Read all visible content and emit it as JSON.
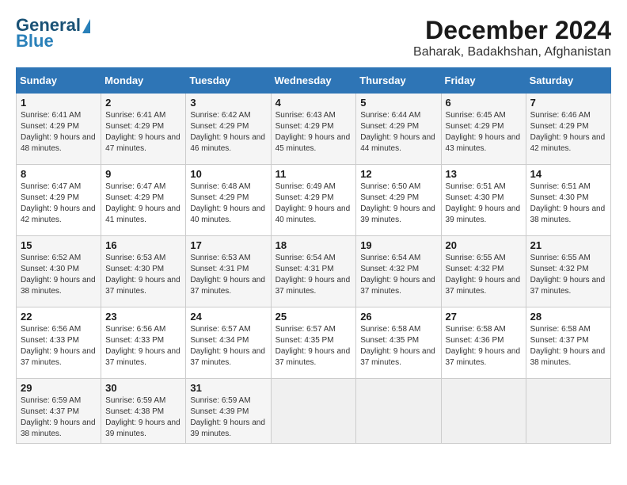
{
  "header": {
    "logo_line1": "General",
    "logo_line2": "Blue",
    "title": "December 2024",
    "subtitle": "Baharak, Badakhshan, Afghanistan"
  },
  "calendar": {
    "columns": [
      "Sunday",
      "Monday",
      "Tuesday",
      "Wednesday",
      "Thursday",
      "Friday",
      "Saturday"
    ],
    "weeks": [
      [
        {
          "day": "",
          "sunrise": "",
          "sunset": "",
          "daylight": ""
        },
        {
          "day": "",
          "sunrise": "",
          "sunset": "",
          "daylight": ""
        },
        {
          "day": "",
          "sunrise": "",
          "sunset": "",
          "daylight": ""
        },
        {
          "day": "",
          "sunrise": "",
          "sunset": "",
          "daylight": ""
        },
        {
          "day": "",
          "sunrise": "",
          "sunset": "",
          "daylight": ""
        },
        {
          "day": "",
          "sunrise": "",
          "sunset": "",
          "daylight": ""
        },
        {
          "day": "",
          "sunrise": "",
          "sunset": "",
          "daylight": ""
        }
      ],
      [
        {
          "day": "1",
          "sunrise": "Sunrise: 6:41 AM",
          "sunset": "Sunset: 4:29 PM",
          "daylight": "Daylight: 9 hours and 48 minutes."
        },
        {
          "day": "2",
          "sunrise": "Sunrise: 6:41 AM",
          "sunset": "Sunset: 4:29 PM",
          "daylight": "Daylight: 9 hours and 47 minutes."
        },
        {
          "day": "3",
          "sunrise": "Sunrise: 6:42 AM",
          "sunset": "Sunset: 4:29 PM",
          "daylight": "Daylight: 9 hours and 46 minutes."
        },
        {
          "day": "4",
          "sunrise": "Sunrise: 6:43 AM",
          "sunset": "Sunset: 4:29 PM",
          "daylight": "Daylight: 9 hours and 45 minutes."
        },
        {
          "day": "5",
          "sunrise": "Sunrise: 6:44 AM",
          "sunset": "Sunset: 4:29 PM",
          "daylight": "Daylight: 9 hours and 44 minutes."
        },
        {
          "day": "6",
          "sunrise": "Sunrise: 6:45 AM",
          "sunset": "Sunset: 4:29 PM",
          "daylight": "Daylight: 9 hours and 43 minutes."
        },
        {
          "day": "7",
          "sunrise": "Sunrise: 6:46 AM",
          "sunset": "Sunset: 4:29 PM",
          "daylight": "Daylight: 9 hours and 42 minutes."
        }
      ],
      [
        {
          "day": "8",
          "sunrise": "Sunrise: 6:47 AM",
          "sunset": "Sunset: 4:29 PM",
          "daylight": "Daylight: 9 hours and 42 minutes."
        },
        {
          "day": "9",
          "sunrise": "Sunrise: 6:47 AM",
          "sunset": "Sunset: 4:29 PM",
          "daylight": "Daylight: 9 hours and 41 minutes."
        },
        {
          "day": "10",
          "sunrise": "Sunrise: 6:48 AM",
          "sunset": "Sunset: 4:29 PM",
          "daylight": "Daylight: 9 hours and 40 minutes."
        },
        {
          "day": "11",
          "sunrise": "Sunrise: 6:49 AM",
          "sunset": "Sunset: 4:29 PM",
          "daylight": "Daylight: 9 hours and 40 minutes."
        },
        {
          "day": "12",
          "sunrise": "Sunrise: 6:50 AM",
          "sunset": "Sunset: 4:29 PM",
          "daylight": "Daylight: 9 hours and 39 minutes."
        },
        {
          "day": "13",
          "sunrise": "Sunrise: 6:51 AM",
          "sunset": "Sunset: 4:30 PM",
          "daylight": "Daylight: 9 hours and 39 minutes."
        },
        {
          "day": "14",
          "sunrise": "Sunrise: 6:51 AM",
          "sunset": "Sunset: 4:30 PM",
          "daylight": "Daylight: 9 hours and 38 minutes."
        }
      ],
      [
        {
          "day": "15",
          "sunrise": "Sunrise: 6:52 AM",
          "sunset": "Sunset: 4:30 PM",
          "daylight": "Daylight: 9 hours and 38 minutes."
        },
        {
          "day": "16",
          "sunrise": "Sunrise: 6:53 AM",
          "sunset": "Sunset: 4:30 PM",
          "daylight": "Daylight: 9 hours and 37 minutes."
        },
        {
          "day": "17",
          "sunrise": "Sunrise: 6:53 AM",
          "sunset": "Sunset: 4:31 PM",
          "daylight": "Daylight: 9 hours and 37 minutes."
        },
        {
          "day": "18",
          "sunrise": "Sunrise: 6:54 AM",
          "sunset": "Sunset: 4:31 PM",
          "daylight": "Daylight: 9 hours and 37 minutes."
        },
        {
          "day": "19",
          "sunrise": "Sunrise: 6:54 AM",
          "sunset": "Sunset: 4:32 PM",
          "daylight": "Daylight: 9 hours and 37 minutes."
        },
        {
          "day": "20",
          "sunrise": "Sunrise: 6:55 AM",
          "sunset": "Sunset: 4:32 PM",
          "daylight": "Daylight: 9 hours and 37 minutes."
        },
        {
          "day": "21",
          "sunrise": "Sunrise: 6:55 AM",
          "sunset": "Sunset: 4:32 PM",
          "daylight": "Daylight: 9 hours and 37 minutes."
        }
      ],
      [
        {
          "day": "22",
          "sunrise": "Sunrise: 6:56 AM",
          "sunset": "Sunset: 4:33 PM",
          "daylight": "Daylight: 9 hours and 37 minutes."
        },
        {
          "day": "23",
          "sunrise": "Sunrise: 6:56 AM",
          "sunset": "Sunset: 4:33 PM",
          "daylight": "Daylight: 9 hours and 37 minutes."
        },
        {
          "day": "24",
          "sunrise": "Sunrise: 6:57 AM",
          "sunset": "Sunset: 4:34 PM",
          "daylight": "Daylight: 9 hours and 37 minutes."
        },
        {
          "day": "25",
          "sunrise": "Sunrise: 6:57 AM",
          "sunset": "Sunset: 4:35 PM",
          "daylight": "Daylight: 9 hours and 37 minutes."
        },
        {
          "day": "26",
          "sunrise": "Sunrise: 6:58 AM",
          "sunset": "Sunset: 4:35 PM",
          "daylight": "Daylight: 9 hours and 37 minutes."
        },
        {
          "day": "27",
          "sunrise": "Sunrise: 6:58 AM",
          "sunset": "Sunset: 4:36 PM",
          "daylight": "Daylight: 9 hours and 37 minutes."
        },
        {
          "day": "28",
          "sunrise": "Sunrise: 6:58 AM",
          "sunset": "Sunset: 4:37 PM",
          "daylight": "Daylight: 9 hours and 38 minutes."
        }
      ],
      [
        {
          "day": "29",
          "sunrise": "Sunrise: 6:59 AM",
          "sunset": "Sunset: 4:37 PM",
          "daylight": "Daylight: 9 hours and 38 minutes."
        },
        {
          "day": "30",
          "sunrise": "Sunrise: 6:59 AM",
          "sunset": "Sunset: 4:38 PM",
          "daylight": "Daylight: 9 hours and 39 minutes."
        },
        {
          "day": "31",
          "sunrise": "Sunrise: 6:59 AM",
          "sunset": "Sunset: 4:39 PM",
          "daylight": "Daylight: 9 hours and 39 minutes."
        },
        {
          "day": "",
          "sunrise": "",
          "sunset": "",
          "daylight": ""
        },
        {
          "day": "",
          "sunrise": "",
          "sunset": "",
          "daylight": ""
        },
        {
          "day": "",
          "sunrise": "",
          "sunset": "",
          "daylight": ""
        },
        {
          "day": "",
          "sunrise": "",
          "sunset": "",
          "daylight": ""
        }
      ]
    ]
  }
}
